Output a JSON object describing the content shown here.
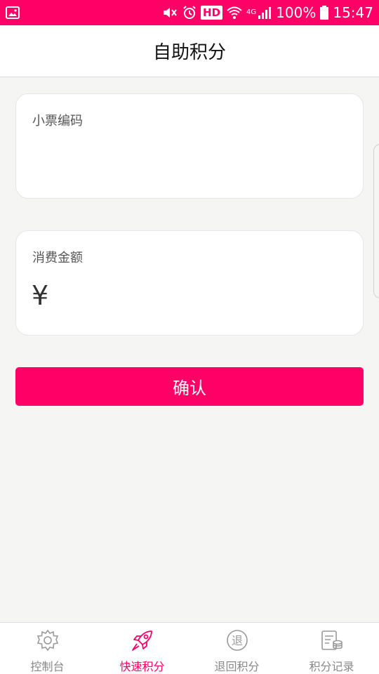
{
  "status_bar": {
    "hd": "HD",
    "network": "4G",
    "battery": "100%",
    "time": "15:47"
  },
  "header": {
    "title": "自助积分"
  },
  "form": {
    "ticket_label": "小票编码",
    "ticket_value": "",
    "amount_label": "消费金额",
    "currency_symbol": "¥",
    "amount_value": ""
  },
  "confirm_label": "确认",
  "tabbar": {
    "items": [
      {
        "label": "控制台",
        "icon": "gear-icon",
        "active": false
      },
      {
        "label": "快速积分",
        "icon": "rocket-icon",
        "active": true
      },
      {
        "label": "退回积分",
        "icon": "return-icon",
        "active": false
      },
      {
        "label": "积分记录",
        "icon": "records-icon",
        "active": false
      }
    ]
  },
  "colors": {
    "accent": "#ff0066",
    "background": "#f5f5f4",
    "inactive_tab": "#888888"
  }
}
